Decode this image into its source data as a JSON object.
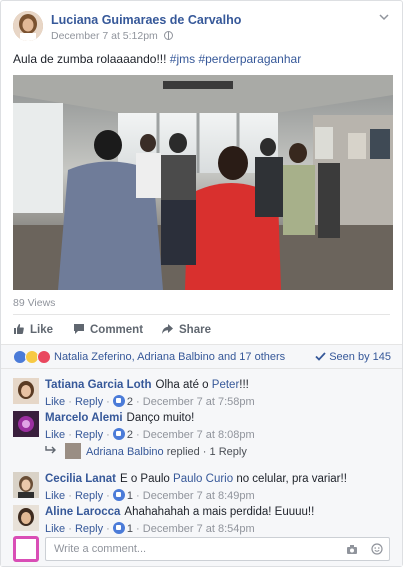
{
  "post": {
    "author": "Luciana Guimaraes de Carvalho",
    "date": "December 7 at 5:12pm",
    "text": "Aula de zumba rolaaaando!!! ",
    "hashtags": "#jms #perderparaganhar",
    "views": "89 Views"
  },
  "actions": {
    "like": "Like",
    "comment": "Comment",
    "share": "Share"
  },
  "reactions": {
    "summary": "Natalia Zeferino, Adriana Balbino and 17 others",
    "seen": "Seen by 145",
    "types": [
      "like-icon",
      "haha-icon",
      "love-icon"
    ]
  },
  "comments": [
    {
      "name": "Tatiana Garcia Loth",
      "text_before": "Olha até o ",
      "mention": "Peter",
      "text_after": "!!!",
      "like_label": "Like",
      "reply_label": "Reply",
      "likes": "2",
      "time": "December 7 at 7:58pm"
    },
    {
      "name": "Marcelo Alemi",
      "text_before": "Danço muito!",
      "mention": "",
      "text_after": "",
      "like_label": "Like",
      "reply_label": "Reply",
      "likes": "2",
      "time": "December 7 at 8:08pm"
    },
    {
      "name": "Cecilia Lanat",
      "text_before": "E o Paulo ",
      "mention": "Paulo Curio",
      "text_after": " no celular, pra variar!!",
      "like_label": "Like",
      "reply_label": "Reply",
      "likes": "1",
      "time": "December 7 at 8:49pm"
    },
    {
      "name": "Aline Larocca",
      "text_before": "Ahahahahah a mais perdida! Euuuu!!",
      "mention": "",
      "text_after": "",
      "like_label": "Like",
      "reply_label": "Reply",
      "likes": "1",
      "time": "December 7 at 8:54pm"
    }
  ],
  "reply_summary": {
    "name": "Adriana Balbino",
    "text": "replied · 1 Reply"
  },
  "composer": {
    "placeholder": "Write a comment..."
  },
  "colors": {
    "link": "#365899",
    "like_blue": "#4b7bd8",
    "meta_gray": "#90949c"
  }
}
